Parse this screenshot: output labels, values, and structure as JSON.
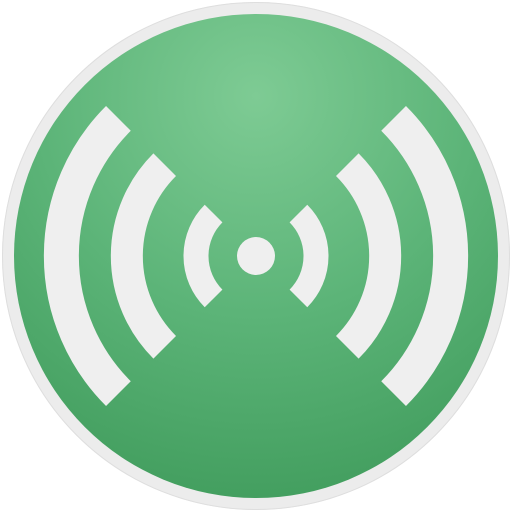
{
  "app_icon": {
    "icon_name": "wireless-broadcast-icon",
    "colors": {
      "ring": "#ececec",
      "ring_edge": "#dedede",
      "disc_center": "#7ecb94",
      "disc_mid": "#5cb478",
      "disc_edge": "#3f9b5b",
      "waves": "#efefef"
    }
  }
}
